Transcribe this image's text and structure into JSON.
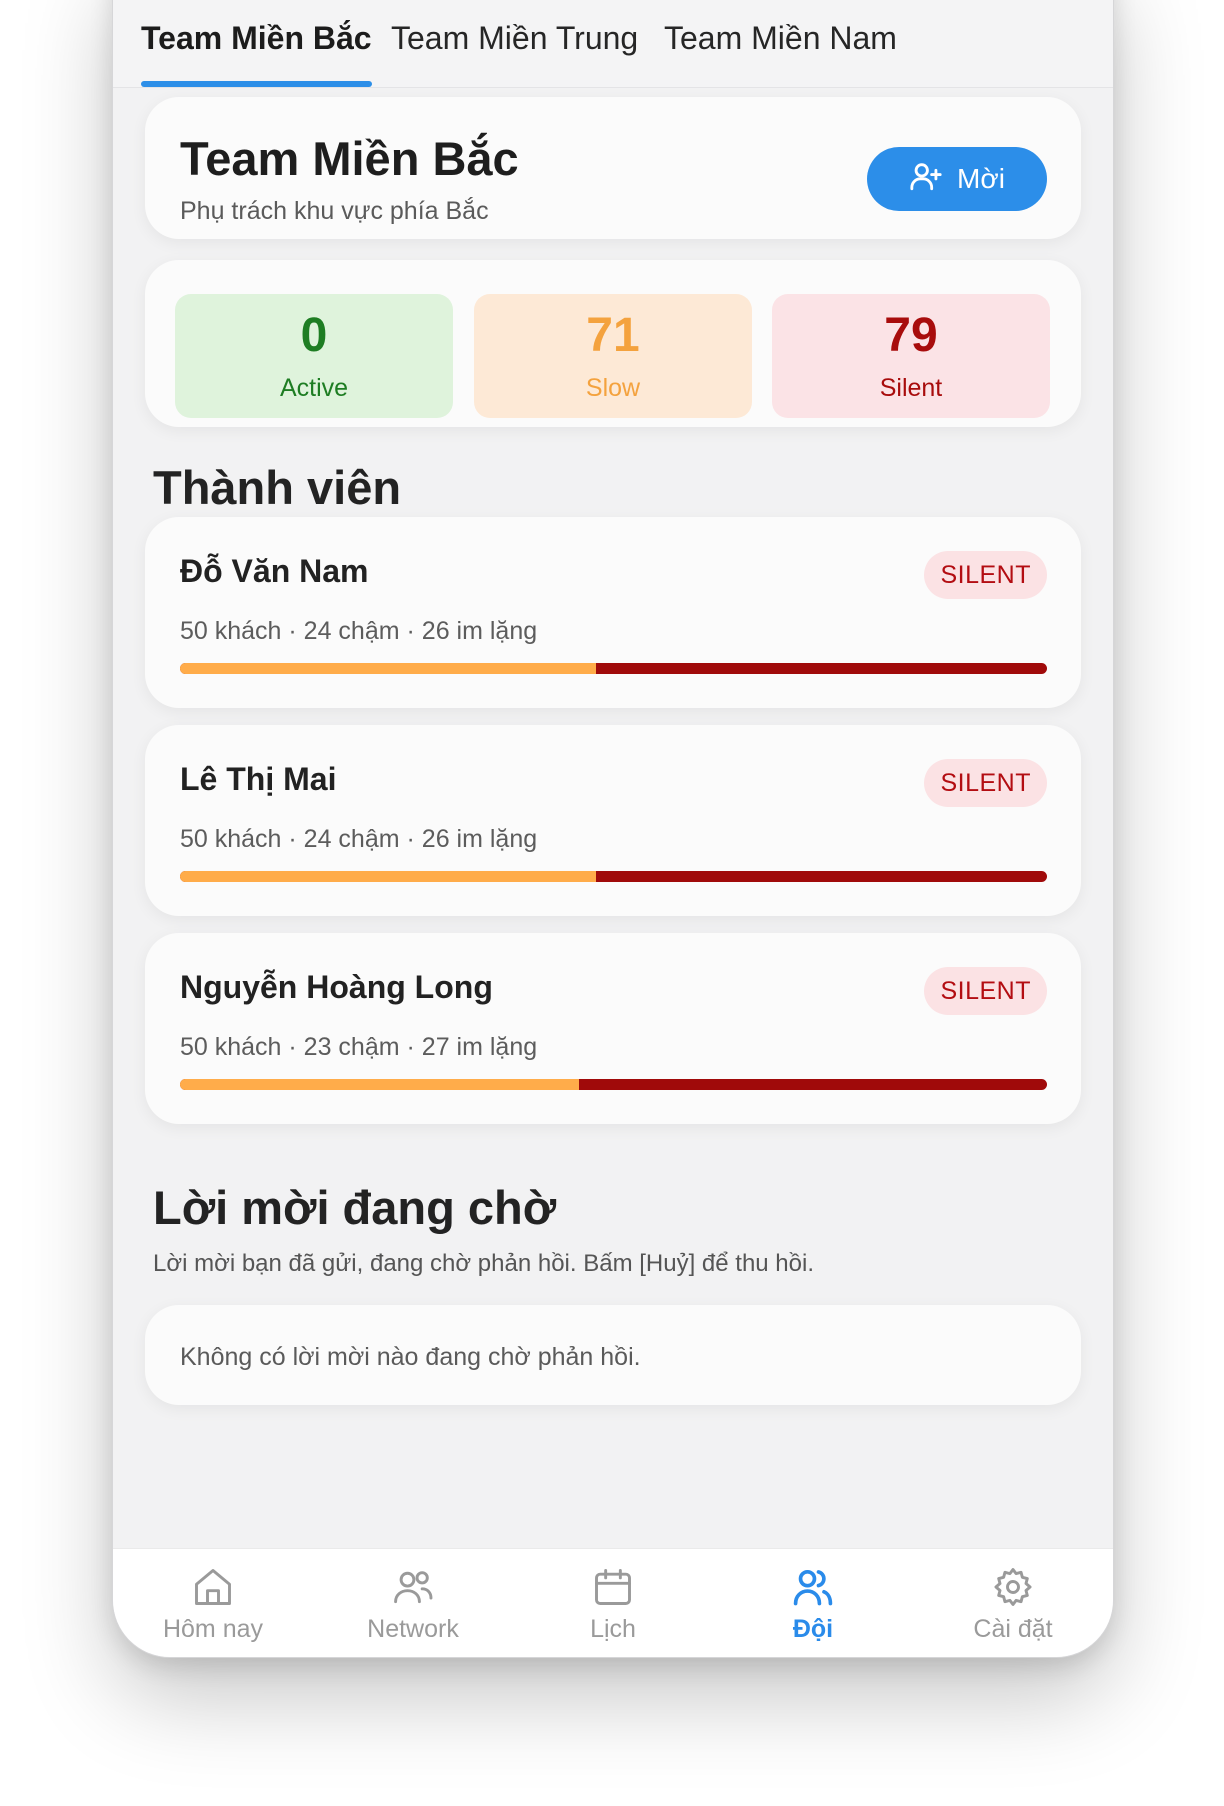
{
  "tabs": [
    {
      "label": "Team Miền Bắc",
      "active": true
    },
    {
      "label": "Team Miền Trung",
      "active": false
    },
    {
      "label": "Team Miền Nam",
      "active": false
    }
  ],
  "team": {
    "title": "Team Miền Bắc",
    "subtitle": "Phụ trách khu vực phía Bắc",
    "invite_label": "Mời",
    "invite_icon": "user-plus-icon"
  },
  "stats": [
    {
      "value": "0",
      "label": "Active",
      "bg": "#dff3dc",
      "color": "#1e7d23"
    },
    {
      "value": "71",
      "label": "Slow",
      "bg": "#fde9d6",
      "color": "#f4a23e"
    },
    {
      "value": "79",
      "label": "Silent",
      "bg": "#fbe3e6",
      "color": "#a80c0c"
    }
  ],
  "members_title": "Thành viên",
  "members": [
    {
      "name": "Đỗ Văn Nam",
      "badge": "SILENT",
      "stats": "50 khách · 24 chậm · 26 im lặng",
      "slow_fraction": 0.48
    },
    {
      "name": "Lê Thị Mai",
      "badge": "SILENT",
      "stats": "50 khách · 24 chậm · 26 im lặng",
      "slow_fraction": 0.48
    },
    {
      "name": "Nguyễn Hoàng Long",
      "badge": "SILENT",
      "stats": "50 khách · 23 chậm · 27 im lặng",
      "slow_fraction": 0.46
    }
  ],
  "pending": {
    "title": "Lời mời đang chờ",
    "subtitle": "Lời mời bạn đã gửi, đang chờ phản hồi. Bấm [Huỷ] để thu hồi.",
    "empty": "Không có lời mời nào đang chờ phản hồi."
  },
  "nav": [
    {
      "label": "Hôm nay",
      "icon": "home-icon",
      "active": false
    },
    {
      "label": "Network",
      "icon": "users-icon",
      "active": false
    },
    {
      "label": "Lịch",
      "icon": "calendar-icon",
      "active": false
    },
    {
      "label": "Đội",
      "icon": "team-icon",
      "active": true
    },
    {
      "label": "Cài đặt",
      "icon": "gear-icon",
      "active": false
    }
  ],
  "colors": {
    "accent": "#2c8ee9",
    "slow": "#ffac4a",
    "silent": "#a00a0a",
    "badge_bg": "#fbe2e4",
    "badge_text": "#b30d12"
  }
}
